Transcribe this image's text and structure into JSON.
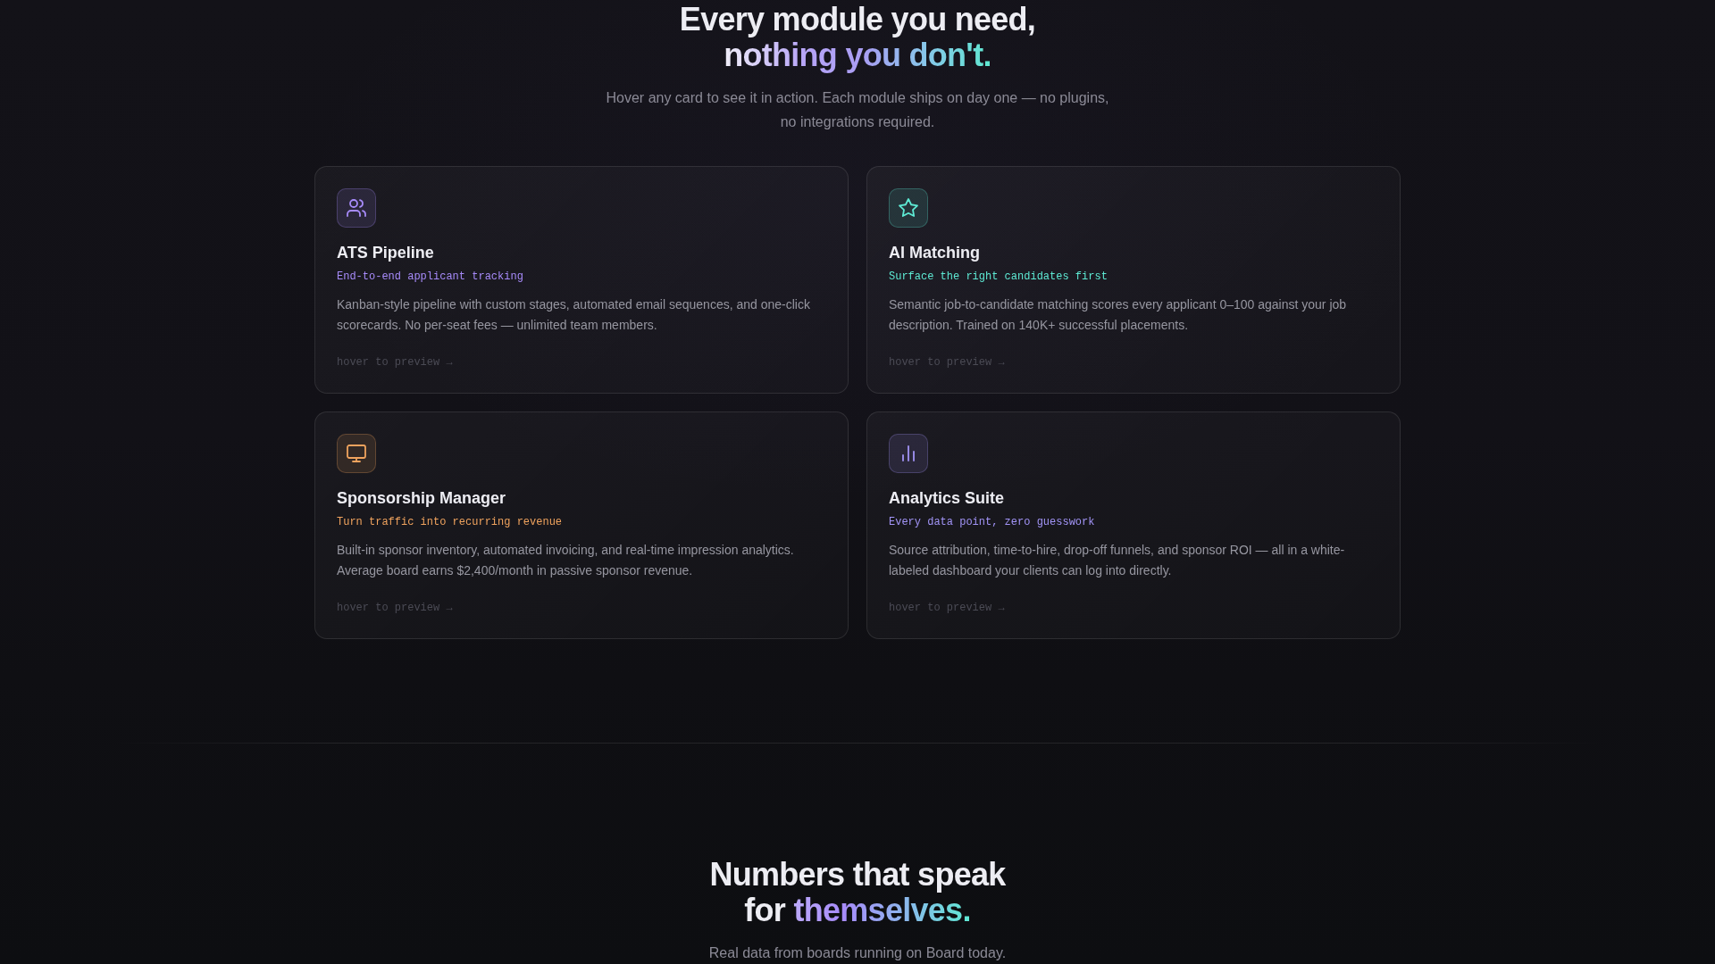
{
  "features": {
    "heading_lines": [
      [
        {
          "text": "Every module you need,",
          "highlight": false
        }
      ],
      [
        {
          "text": "nothing you don't.",
          "highlight": true
        }
      ]
    ],
    "subtitle": "Hover any card to see it in action. Each module ships on day one — no plugins, no integrations required.",
    "cards": [
      {
        "title": "ATS Pipeline",
        "tagline": "End-to-end applicant tracking",
        "description": "Kanban-style pipeline with custom stages, automated email sequences, and one-click scorecards. No per-seat fees — unlimited team members.",
        "hint": "hover to preview →",
        "color": "#a78bfa"
      },
      {
        "title": "AI Matching",
        "tagline": "Surface the right candidates first",
        "description": "Semantic job-to-candidate matching scores every applicant 0–100 against your job description. Trained on 140K+ successful placements.",
        "hint": "hover to preview →",
        "color": "#5eead4"
      },
      {
        "title": "Sponsorship Manager",
        "tagline": "Turn traffic into recurring revenue",
        "description": "Built-in sponsor inventory, automated invoicing, and real-time impression analytics. Average board earns $2,400/month in passive sponsor revenue.",
        "hint": "hover to preview →",
        "color": "#f0a35e"
      },
      {
        "title": "Analytics Suite",
        "tagline": "Every data point, zero guesswork",
        "description": "Source attribution, time-to-hire, drop-off funnels, and sponsor ROI — all in a white-labeled dashboard your clients can log into directly.",
        "hint": "hover to preview →",
        "color": "#a294f7"
      }
    ]
  },
  "stats": {
    "heading_lines": [
      [
        {
          "text": "Numbers that speak",
          "highlight": false
        }
      ],
      [
        {
          "text": "for",
          "highlight": false
        },
        {
          "text": "themselves.",
          "highlight": true
        }
      ]
    ],
    "subtitle": "Real data from boards running on Board today."
  }
}
